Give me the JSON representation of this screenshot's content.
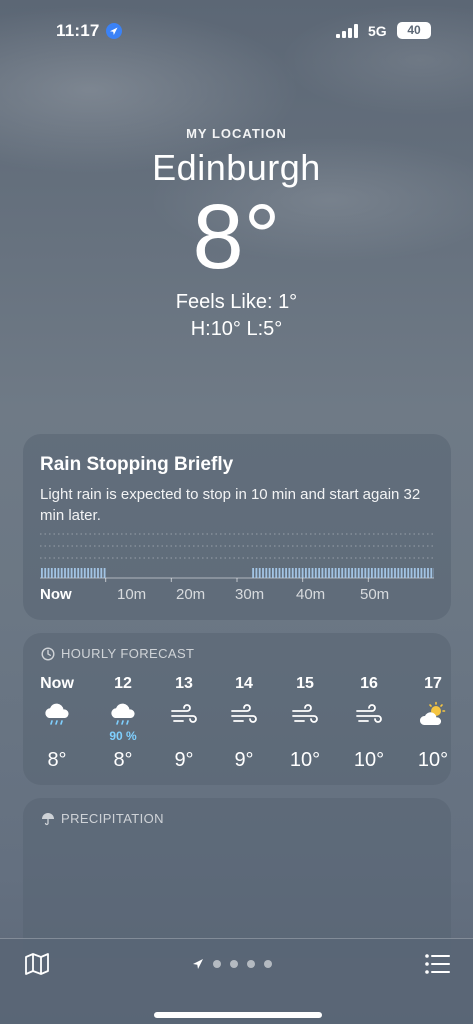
{
  "status": {
    "time": "11:17",
    "network": "5G",
    "battery": "40"
  },
  "header": {
    "my_location": "MY LOCATION",
    "city": "Edinburgh",
    "temperature": "8°",
    "feels_like": "Feels Like: 1°",
    "hi_lo": "H:10°  L:5°"
  },
  "rain_card": {
    "title": "Rain Stopping Briefly",
    "description": "Light rain is expected to stop in 10 min and start again 32 min later.",
    "time_labels": [
      "Now",
      "10m",
      "20m",
      "30m",
      "40m",
      "50m"
    ],
    "rain_intervals_min": [
      [
        0,
        10
      ],
      [
        32,
        60
      ]
    ]
  },
  "hourly": {
    "heading": "HOURLY FORECAST",
    "items": [
      {
        "label": "Now",
        "icon": "cloud-rain-icon",
        "pop": "",
        "temp": "8°"
      },
      {
        "label": "12",
        "icon": "cloud-rain-icon",
        "pop": "90 %",
        "temp": "8°"
      },
      {
        "label": "13",
        "icon": "wind-icon",
        "pop": "",
        "temp": "9°"
      },
      {
        "label": "14",
        "icon": "wind-icon",
        "pop": "",
        "temp": "9°"
      },
      {
        "label": "15",
        "icon": "wind-icon",
        "pop": "",
        "temp": "10°"
      },
      {
        "label": "16",
        "icon": "wind-icon",
        "pop": "",
        "temp": "10°"
      },
      {
        "label": "17",
        "icon": "partly-sunny-icon",
        "pop": "",
        "temp": "10°"
      }
    ]
  },
  "precipitation": {
    "heading": "PRECIPITATION"
  },
  "bottom_bar": {
    "page_count": 5,
    "current_page": 0
  },
  "colors": {
    "precip_highlight": "#7fd0ff",
    "sun": "#f5c542"
  }
}
